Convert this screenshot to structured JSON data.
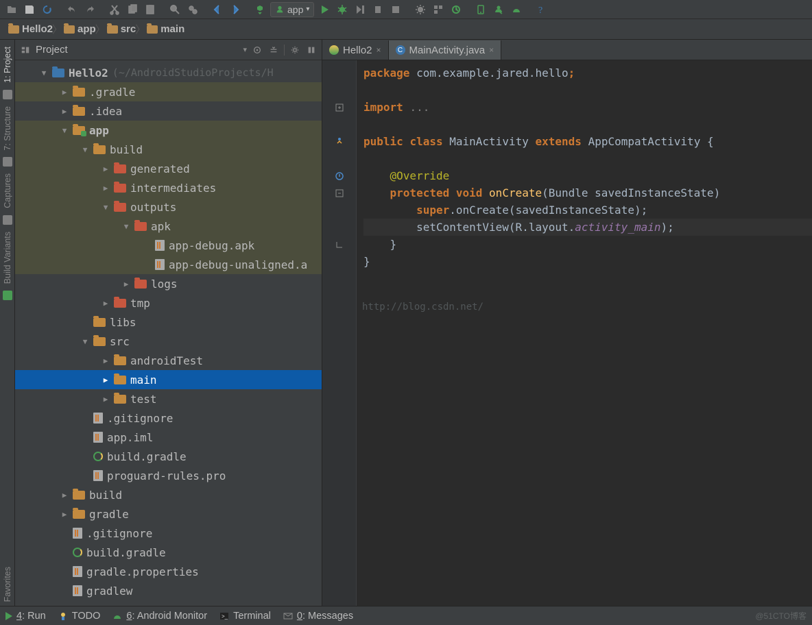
{
  "run_config": {
    "label": "app"
  },
  "breadcrumbs": [
    "Hello2",
    "app",
    "src",
    "main"
  ],
  "pane_header": {
    "title": "Project"
  },
  "left_tabs": [
    "1: Project",
    "7: Structure",
    "Captures",
    "Build Variants",
    "Favorites"
  ],
  "tree": [
    {
      "d": 0,
      "a": "▼",
      "ic": "folder-blue",
      "t": "Hello2",
      "extra": "(~/AndroidStudioProjects/H",
      "hl": false,
      "bold": true
    },
    {
      "d": 1,
      "a": "▶",
      "ic": "folder",
      "t": ".gradle",
      "hl": true
    },
    {
      "d": 1,
      "a": "▶",
      "ic": "folder",
      "t": ".idea"
    },
    {
      "d": 1,
      "a": "▼",
      "ic": "folder-mod",
      "t": "app",
      "hl": true,
      "bold": true
    },
    {
      "d": 2,
      "a": "▼",
      "ic": "folder",
      "t": "build",
      "hl": true
    },
    {
      "d": 3,
      "a": "▶",
      "ic": "folder-red",
      "t": "generated",
      "hl": true
    },
    {
      "d": 3,
      "a": "▶",
      "ic": "folder-red",
      "t": "intermediates",
      "hl": true
    },
    {
      "d": 3,
      "a": "▼",
      "ic": "folder-red",
      "t": "outputs",
      "hl": true
    },
    {
      "d": 4,
      "a": "▼",
      "ic": "folder-red",
      "t": "apk",
      "hl": true
    },
    {
      "d": 5,
      "a": "",
      "ic": "file",
      "t": "app-debug.apk",
      "hl": true
    },
    {
      "d": 5,
      "a": "",
      "ic": "file",
      "t": "app-debug-unaligned.a",
      "hl": true
    },
    {
      "d": 4,
      "a": "▶",
      "ic": "folder-red",
      "t": "logs"
    },
    {
      "d": 3,
      "a": "▶",
      "ic": "folder-red",
      "t": "tmp"
    },
    {
      "d": 2,
      "a": "",
      "ic": "folder",
      "t": "libs"
    },
    {
      "d": 2,
      "a": "▼",
      "ic": "folder",
      "t": "src"
    },
    {
      "d": 3,
      "a": "▶",
      "ic": "folder",
      "t": "androidTest"
    },
    {
      "d": 3,
      "a": "▶",
      "ic": "folder",
      "t": "main",
      "sel": true
    },
    {
      "d": 3,
      "a": "▶",
      "ic": "folder",
      "t": "test"
    },
    {
      "d": 2,
      "a": "",
      "ic": "file",
      "t": ".gitignore"
    },
    {
      "d": 2,
      "a": "",
      "ic": "file",
      "t": "app.iml"
    },
    {
      "d": 2,
      "a": "",
      "ic": "gradle",
      "t": "build.gradle"
    },
    {
      "d": 2,
      "a": "",
      "ic": "file",
      "t": "proguard-rules.pro"
    },
    {
      "d": 1,
      "a": "▶",
      "ic": "folder",
      "t": "build"
    },
    {
      "d": 1,
      "a": "▶",
      "ic": "folder",
      "t": "gradle"
    },
    {
      "d": 1,
      "a": "",
      "ic": "file",
      "t": ".gitignore"
    },
    {
      "d": 1,
      "a": "",
      "ic": "gradle",
      "t": "build.gradle"
    },
    {
      "d": 1,
      "a": "",
      "ic": "file",
      "t": "gradle.properties"
    },
    {
      "d": 1,
      "a": "",
      "ic": "file",
      "t": "gradlew"
    }
  ],
  "tabs": [
    {
      "label": "Hello2",
      "active": false,
      "icon": "g"
    },
    {
      "label": "MainActivity.java",
      "active": true,
      "icon": "b"
    }
  ],
  "code": {
    "package_kw": "package",
    "package_name": "com.example.jared.hello",
    "import_kw": "import",
    "ellipsis": "...",
    "public": "public",
    "class": "class",
    "cls": "MainActivity",
    "extends": "extends",
    "supercls": "AppCompatActivity",
    "override": "@Override",
    "protected": "protected",
    "void": "void",
    "onCreate": "onCreate",
    "params": "(Bundle savedInstanceState)",
    "superCall": "super",
    "dot": ".onCreate(savedInstanceState);",
    "set": "setContentView(R.layout.",
    "actmain": "activity_main",
    "close": ");",
    "watermark": "http://blog.csdn.net/"
  },
  "bottom": {
    "run": "4: Run",
    "todo": "TODO",
    "monitor": "6: Android Monitor",
    "terminal": "Terminal",
    "messages": "0: Messages",
    "corner": "@51CTO博客"
  }
}
